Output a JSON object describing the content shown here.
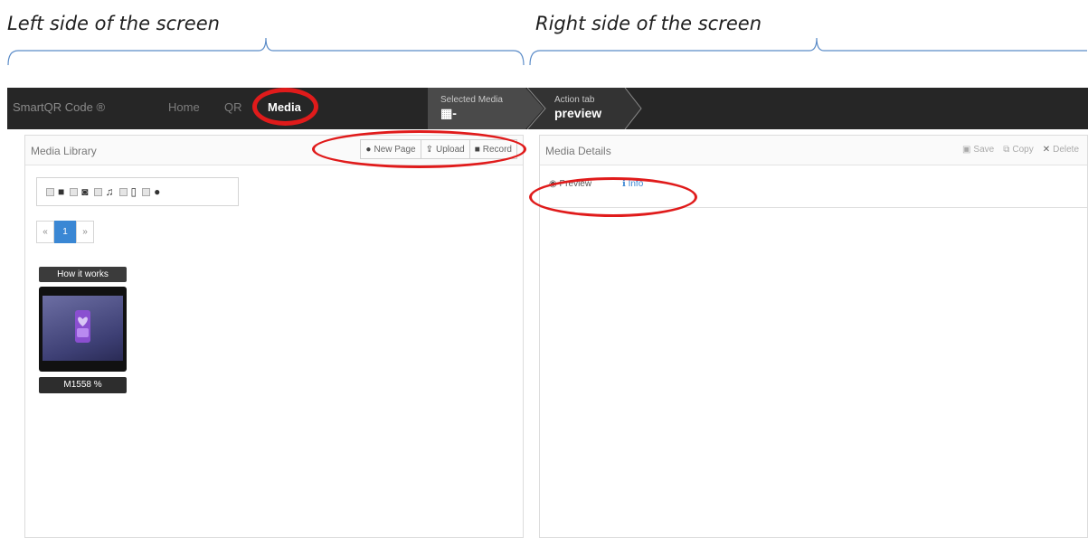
{
  "annotations": {
    "left_caption": "Left side of the screen",
    "right_caption": "Right side of the screen"
  },
  "navbar": {
    "brand": "SmartQR Code ®",
    "links": [
      "Home",
      "QR",
      "Media"
    ],
    "active": "Media",
    "steps": [
      {
        "label": "Selected Media",
        "value": "-",
        "icon": "film-icon"
      },
      {
        "label": "Action tab",
        "value": "preview"
      }
    ]
  },
  "library": {
    "title": "Media Library",
    "buttons": [
      {
        "label": "New Page",
        "icon": "globe-icon"
      },
      {
        "label": "Upload",
        "icon": "upload-icon"
      },
      {
        "label": "Record",
        "icon": "video-icon"
      }
    ],
    "filters": [
      "video-icon",
      "camera-icon",
      "music-icon",
      "file-icon",
      "globe-icon"
    ],
    "pagination": {
      "prev": "«",
      "current": "1",
      "next": "»"
    },
    "items": [
      {
        "title": "How it works",
        "id": "M1558",
        "icon": "link-icon"
      }
    ]
  },
  "details": {
    "title": "Media Details",
    "buttons": [
      {
        "label": "Save",
        "icon": "save-icon"
      },
      {
        "label": "Copy",
        "icon": "copy-icon"
      },
      {
        "label": "Delete",
        "icon": "close-icon"
      }
    ],
    "tabs": [
      {
        "label": "Preview",
        "icon": "eye-icon"
      },
      {
        "label": "Info",
        "icon": "info-icon"
      }
    ],
    "active_tab": "Info"
  },
  "colors": {
    "navbar": "#262626",
    "accent": "#3a87d4",
    "annotation_red": "#e01b1b"
  }
}
